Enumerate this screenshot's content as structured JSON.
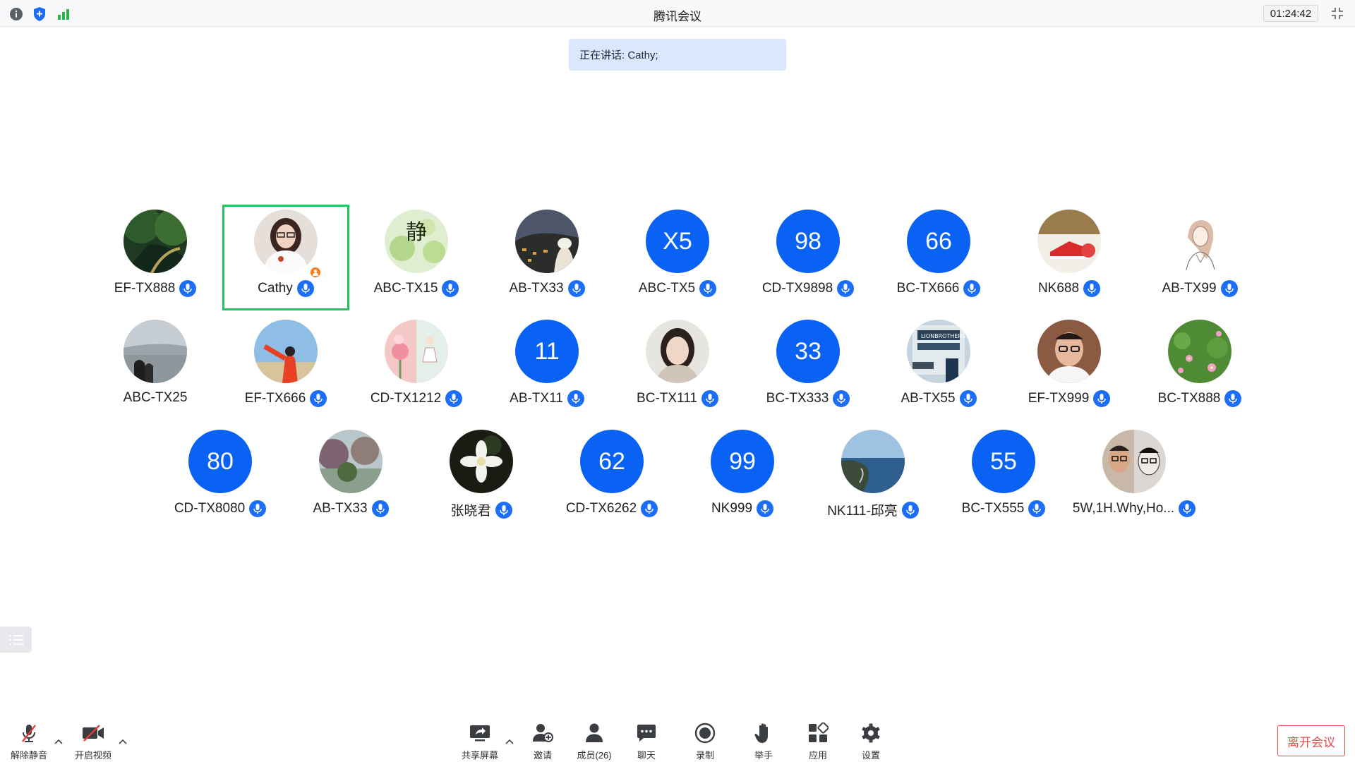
{
  "window": {
    "title": "腾讯会议",
    "timer": "01:24:42"
  },
  "speaking": {
    "text": "正在讲话: Cathy;"
  },
  "colors": {
    "accent": "#0a62f5",
    "active_border": "#2bbf62",
    "leave": "#e24c4c",
    "host_badge": "#ff7a1a"
  },
  "participants": [
    {
      "name": "EF-TX888",
      "avatar": "photo-forest-road"
    },
    {
      "name": "Cathy",
      "avatar": "photo-woman-white-shirt",
      "host": true,
      "speaking": true
    },
    {
      "name": "ABC-TX15",
      "avatar": "photo-green-calligraphy"
    },
    {
      "name": "AB-TX33",
      "avatar": "photo-hillside-town"
    },
    {
      "name": "ABC-TX5",
      "initials": "X5"
    },
    {
      "name": "CD-TX9898",
      "initials": "98"
    },
    {
      "name": "BC-TX666",
      "initials": "66"
    },
    {
      "name": "NK688",
      "avatar": "photo-red-shoe"
    },
    {
      "name": "AB-TX99",
      "avatar": "sketch-girl"
    },
    {
      "name": "ABC-TX25",
      "avatar": "photo-sea-couple",
      "no_mic": true
    },
    {
      "name": "EF-TX666",
      "avatar": "photo-red-jacket-beach"
    },
    {
      "name": "CD-TX1212",
      "avatar": "illustration-pink-flowers"
    },
    {
      "name": "AB-TX11",
      "initials": "11"
    },
    {
      "name": "BC-TX111",
      "avatar": "photo-woman-portrait"
    },
    {
      "name": "BC-TX333",
      "initials": "33"
    },
    {
      "name": "AB-TX55",
      "avatar": "photo-building-sign"
    },
    {
      "name": "EF-TX999",
      "avatar": "photo-man-glasses"
    },
    {
      "name": "BC-TX888",
      "avatar": "photo-pink-flower-field"
    },
    {
      "name": "CD-TX8080",
      "initials": "80"
    },
    {
      "name": "AB-TX33",
      "avatar": "photo-lake-trees"
    },
    {
      "name": "张晓君",
      "avatar": "photo-white-flower"
    },
    {
      "name": "CD-TX6262",
      "initials": "62"
    },
    {
      "name": "NK999",
      "initials": "99"
    },
    {
      "name": "NK111-邱亮",
      "avatar": "photo-coastline"
    },
    {
      "name": "BC-TX555",
      "initials": "55"
    },
    {
      "name": "5W,1H.Why,Ho...",
      "avatar": "photo-two-men-glasses"
    }
  ],
  "toolbar": {
    "unmute": "解除静音",
    "start_video": "开启视频",
    "share_screen": "共享屏幕",
    "invite": "邀请",
    "members": "成员(26)",
    "chat": "聊天",
    "record": "录制",
    "raise_hand": "举手",
    "apps": "应用",
    "settings": "设置",
    "leave": "离开会议"
  }
}
